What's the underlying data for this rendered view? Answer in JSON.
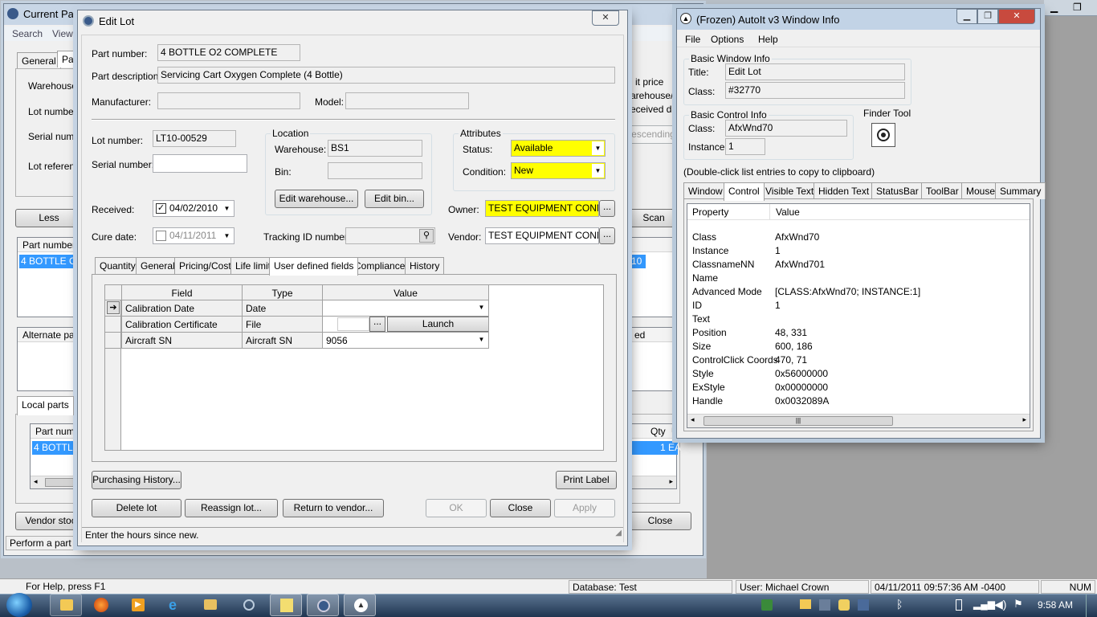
{
  "colors": {
    "accent": "#3399ff",
    "highlight_yellow": "#ffff00",
    "close_red": "#c84a3e"
  },
  "bg_window": {
    "title": "Current Parts",
    "menu": [
      "Search",
      "View"
    ],
    "tabs": [
      "General",
      "Part"
    ],
    "labels": [
      "Warehouse:",
      "Lot number:",
      "Serial number",
      "Lot reference"
    ],
    "right_labels": [
      "it price",
      "arehouse/B",
      "eceived date"
    ],
    "right_disabled": "escending",
    "scan_btn": "Scan",
    "less_btn": "Less",
    "col_part_number": "Part number",
    "row_selected": "4 BOTTLE O2",
    "row_selected_right": "10",
    "alternate_part": "Alternate part",
    "ed_col": "ed",
    "local_parts_tab": "Local parts",
    "local_col": "Part numb",
    "local_row": "4 BOTTLE",
    "qty_col": "Qty",
    "u_col": "U",
    "qty_val": "1",
    "ea_val": "EA",
    "vendor_stock_btn": "Vendor stock",
    "close_btn": "Close",
    "status": "Perform a part r"
  },
  "edit_lot": {
    "title": "Edit Lot",
    "part_number_label": "Part number:",
    "part_number": "4 BOTTLE O2 COMPLETE",
    "part_desc_label": "Part description:",
    "part_desc": "Servicing Cart Oxygen Complete (4 Bottle)",
    "manufacturer_label": "Manufacturer:",
    "model_label": "Model:",
    "lot_number_label": "Lot number:",
    "lot_number": "LT10-00529",
    "serial_label": "Serial number:",
    "location_group": "Location",
    "warehouse_label": "Warehouse:",
    "warehouse": "BS1",
    "bin_label": "Bin:",
    "edit_warehouse_btn": "Edit warehouse...",
    "edit_bin_btn": "Edit bin...",
    "attributes_group": "Attributes",
    "status_label": "Status:",
    "status": "Available",
    "condition_label": "Condition:",
    "condition": "New",
    "received_label": "Received:",
    "received": "04/02/2010",
    "cure_label": "Cure date:",
    "cure": "04/11/2011",
    "tracking_label": "Tracking ID number:",
    "owner_label": "Owner:",
    "owner": "TEST EQUIPMENT CONNEC",
    "vendor_label": "Vendor:",
    "vendor": "TEST EQUIPMENT CONNEC",
    "tabs": [
      "Quantity",
      "General",
      "Pricing/Cost",
      "Life limit",
      "User defined fields",
      "Compliance",
      "History"
    ],
    "grid": {
      "headers": [
        "Field",
        "Type",
        "Value"
      ],
      "rows": [
        {
          "field": "Calibration Date",
          "type": "Date",
          "value": ""
        },
        {
          "field": "Calibration Certificate",
          "type": "File",
          "value": "",
          "browse": "...",
          "launch": "Launch"
        },
        {
          "field": "Aircraft SN",
          "type": "Aircraft SN",
          "value": "9056"
        }
      ]
    },
    "purchasing_btn": "Purchasing History...",
    "print_label_btn": "Print Label",
    "delete_btn": "Delete lot",
    "reassign_btn": "Reassign lot...",
    "return_btn": "Return to vendor...",
    "ok_btn": "OK",
    "close_btn": "Close",
    "apply_btn": "Apply",
    "status_text": "Enter the hours since new."
  },
  "autoit": {
    "title": "(Frozen) AutoIt v3 Window Info",
    "menu": [
      "File",
      "Options",
      "Help"
    ],
    "basic_window_info": "Basic Window Info",
    "title_label": "Title:",
    "title_value": "Edit Lot",
    "class_label": "Class:",
    "class_value": "#32770",
    "basic_control_info": "Basic Control Info",
    "control_class_label": "Class:",
    "control_class": "AfxWnd70",
    "instance_label": "Instance:",
    "instance": "1",
    "finder_tool": "Finder Tool",
    "hint": "(Double-click list entries to copy to clipboard)",
    "tabs": [
      "Window",
      "Control",
      "Visible Text",
      "Hidden Text",
      "StatusBar",
      "ToolBar",
      "Mouse",
      "Summary"
    ],
    "columns": [
      "Property",
      "Value"
    ],
    "properties": [
      {
        "k": "Class",
        "v": "AfxWnd70"
      },
      {
        "k": "Instance",
        "v": "1"
      },
      {
        "k": "ClassnameNN",
        "v": "AfxWnd701"
      },
      {
        "k": "Name",
        "v": ""
      },
      {
        "k": "Advanced Mode",
        "v": "[CLASS:AfxWnd70; INSTANCE:1]"
      },
      {
        "k": "ID",
        "v": "1"
      },
      {
        "k": "Text",
        "v": ""
      },
      {
        "k": "Position",
        "v": "48, 331"
      },
      {
        "k": "Size",
        "v": "600, 186"
      },
      {
        "k": "ControlClick Coords",
        "v": "470, 71"
      },
      {
        "k": "Style",
        "v": "0x56000000"
      },
      {
        "k": "ExStyle",
        "v": "0x00000000"
      },
      {
        "k": "Handle",
        "v": "0x0032089A"
      }
    ]
  },
  "app_statusbar": {
    "help": "For Help, press F1",
    "database": "Database: Test",
    "user": "User: Michael Crown",
    "datetime": "04/11/2011 09:57:36 AM -0400",
    "num": "NUM"
  },
  "taskbar": {
    "clock": "9:58 AM"
  }
}
